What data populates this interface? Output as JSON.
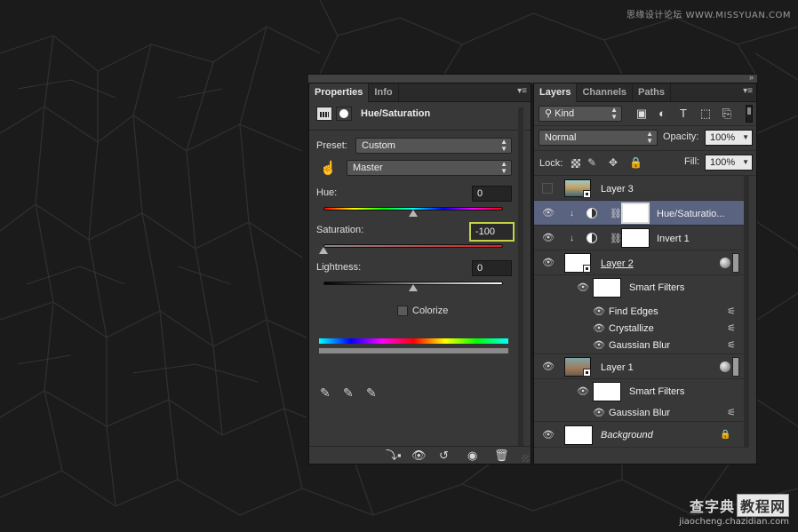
{
  "watermark": {
    "top": "思缘设计论坛 WWW.MISSYUAN.COM",
    "bottom_title": "查字典",
    "bottom_box": "教程网",
    "bottom_url": "jiaocheng.chazidian.com"
  },
  "properties": {
    "tabs": [
      "Properties",
      "Info"
    ],
    "header_title": "Hue/Saturation",
    "preset_label": "Preset:",
    "preset_value": "Custom",
    "channel_value": "Master",
    "hue_label": "Hue:",
    "hue_value": "0",
    "saturation_label": "Saturation:",
    "saturation_value": "-100",
    "lightness_label": "Lightness:",
    "lightness_value": "0",
    "colorize_label": "Colorize",
    "colorize_checked": false,
    "slider_levels": {
      "hue": 0,
      "saturation": -100,
      "lightness": 0
    }
  },
  "layers": {
    "tabs": [
      "Layers",
      "Channels",
      "Paths"
    ],
    "filter_kind": "Kind",
    "blend_mode": "Normal",
    "opacity_label": "Opacity:",
    "opacity_value": "100%",
    "lock_label": "Lock:",
    "fill_label": "Fill:",
    "fill_value": "100%",
    "items": [
      {
        "name": "Layer 3",
        "visible": false
      },
      {
        "name": "Hue/Saturatio...",
        "visible": true,
        "selected": true
      },
      {
        "name": "Invert 1",
        "visible": true
      },
      {
        "name": "Layer 2",
        "visible": true
      },
      {
        "name": "Smart Filters",
        "visible": true
      },
      {
        "name": "Find Edges",
        "visible": true
      },
      {
        "name": "Crystallize",
        "visible": true
      },
      {
        "name": "Gaussian Blur",
        "visible": true
      },
      {
        "name": "Layer 1",
        "visible": true
      },
      {
        "name": "Smart Filters",
        "visible": true
      },
      {
        "name": "Gaussian Blur",
        "visible": true
      },
      {
        "name": "Background",
        "visible": true,
        "locked": true
      }
    ]
  },
  "colors": {
    "panel_bg": "#383838",
    "selected_row": "#5a6380",
    "highlight_border": "#c4d24a"
  }
}
